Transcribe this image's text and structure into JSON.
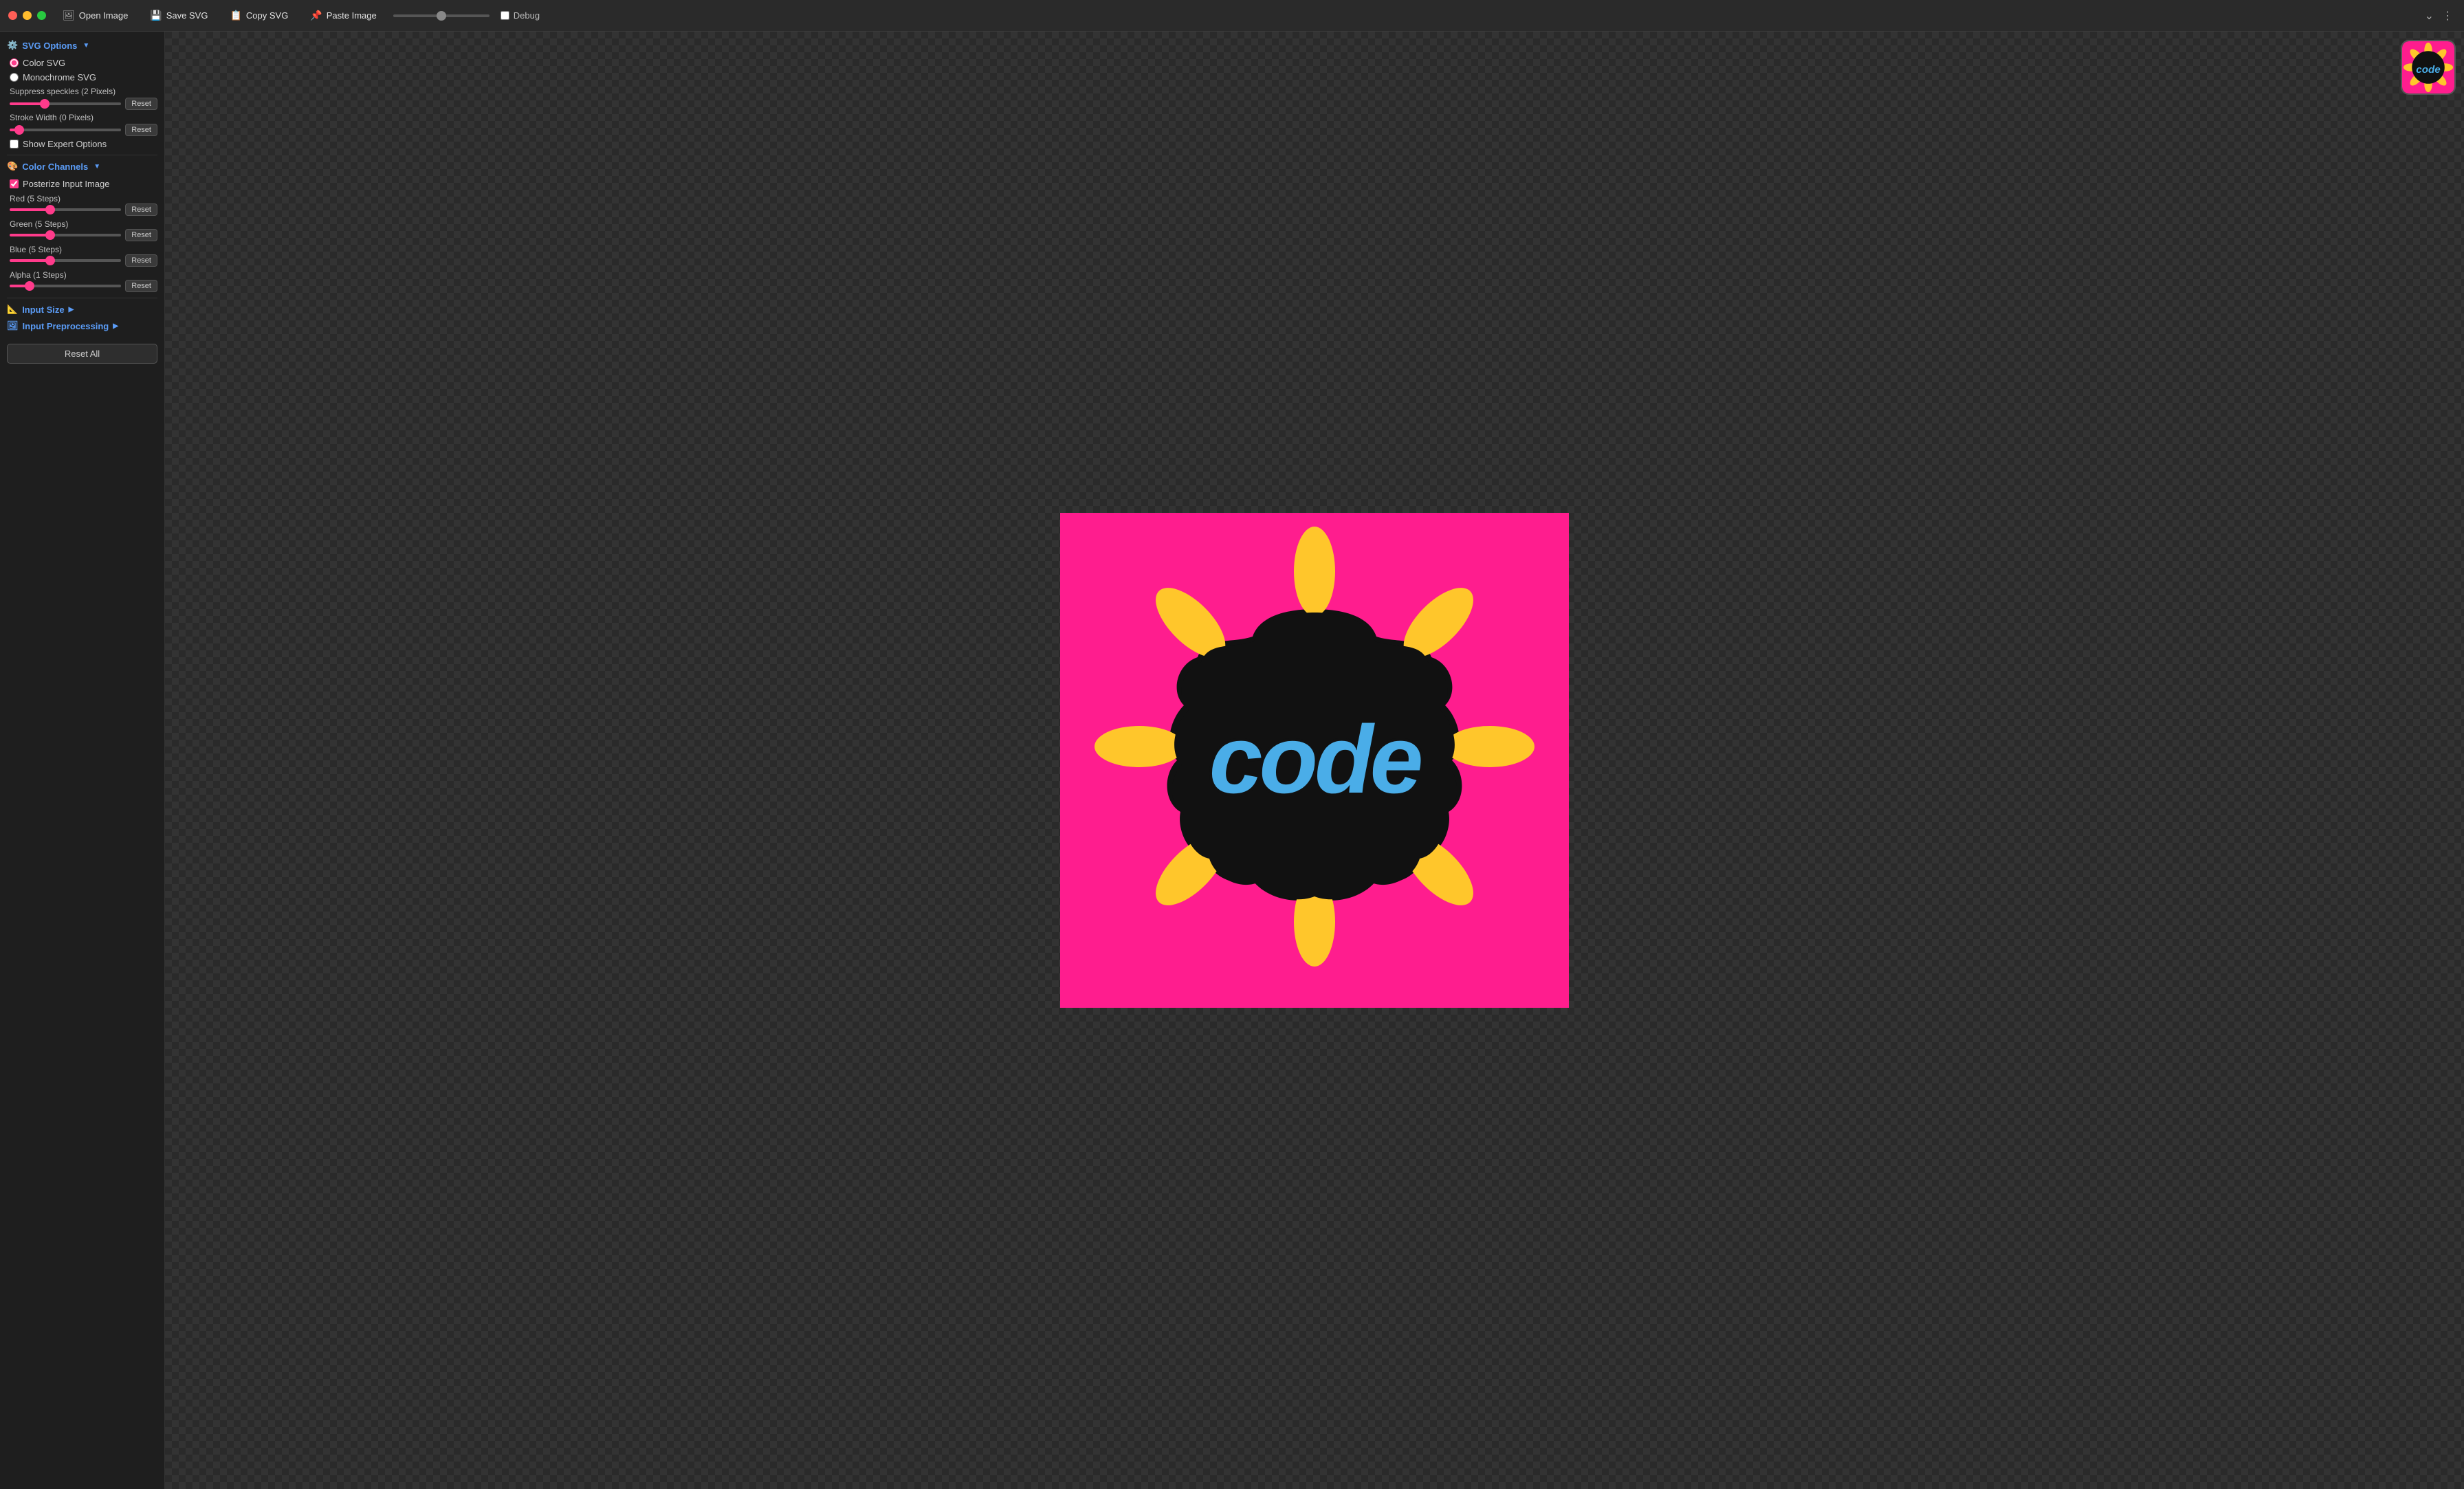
{
  "titlebar": {
    "traffic_lights": [
      "red",
      "yellow",
      "green"
    ],
    "buttons": [
      {
        "id": "open-image",
        "label": "Open Image",
        "icon": "🖼"
      },
      {
        "id": "save-svg",
        "label": "Save SVG",
        "icon": "💾"
      },
      {
        "id": "copy-svg",
        "label": "Copy SVG",
        "icon": "📋"
      },
      {
        "id": "paste-image",
        "label": "Paste Image",
        "icon": "📌"
      }
    ],
    "debug_label": "Debug",
    "actions": [
      "chevron-down",
      "ellipsis"
    ]
  },
  "sidebar": {
    "svg_options_label": "SVG Options",
    "color_svg_label": "Color SVG",
    "monochrome_svg_label": "Monochrome SVG",
    "suppress_speckles_label": "Suppress speckles (2 Pixels)",
    "suppress_speckles_value": 30,
    "stroke_width_label": "Stroke Width (0 Pixels)",
    "stroke_width_value": 5,
    "show_expert_label": "Show Expert Options",
    "color_channels_label": "Color Channels",
    "posterize_label": "Posterize Input Image",
    "red_label": "Red (5 Steps)",
    "red_value": 35,
    "green_label": "Green (5 Steps)",
    "green_value": 35,
    "blue_label": "Blue (5 Steps)",
    "blue_value": 35,
    "alpha_label": "Alpha (1 Steps)",
    "alpha_value": 15,
    "reset_label": "Reset",
    "input_size_label": "Input Size",
    "input_preprocessing_label": "Input Preprocessing",
    "reset_all_label": "Reset All"
  },
  "colors": {
    "accent_blue": "#5b9cf6",
    "accent_pink": "#ff3b8b",
    "bg_dark": "#1e1e1e",
    "bg_main": "#2a2a2a"
  }
}
